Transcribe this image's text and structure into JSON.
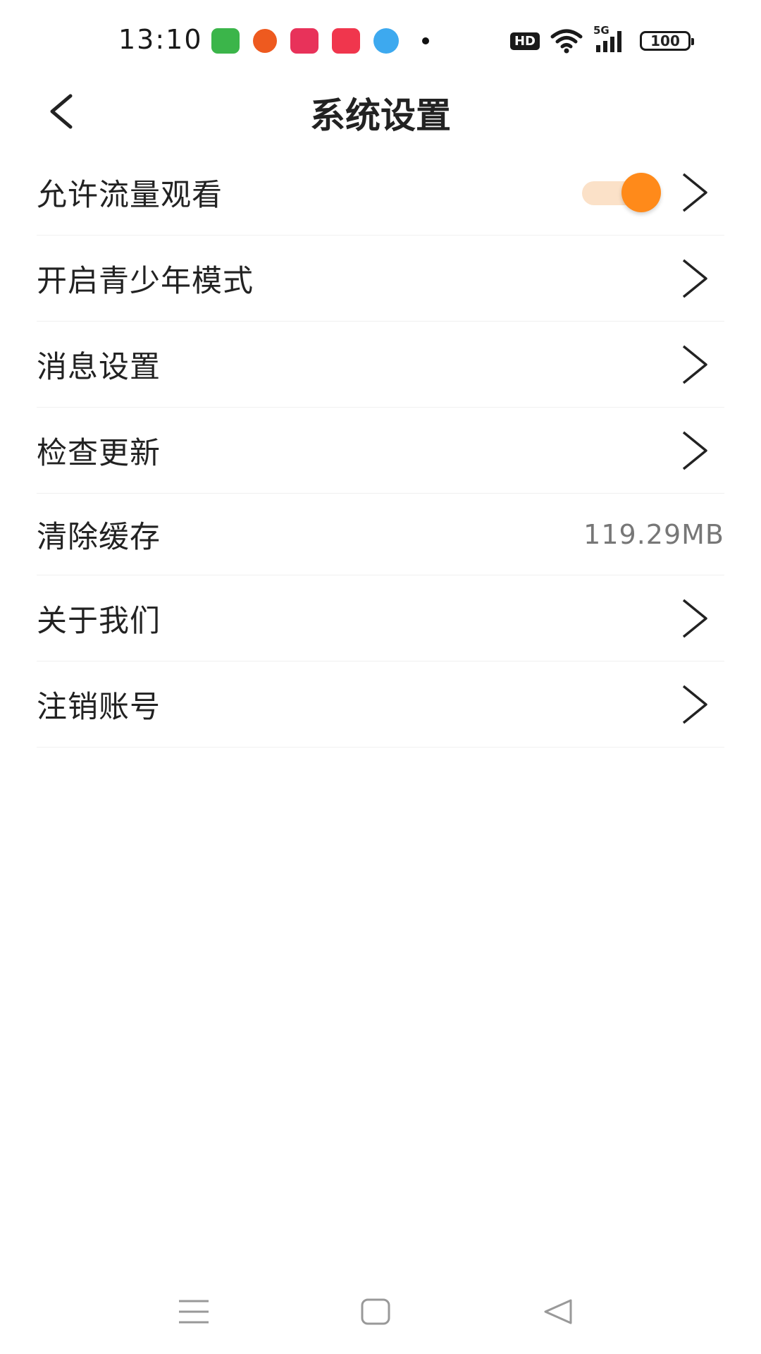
{
  "status_bar": {
    "time": "13:10",
    "hd_badge": "HD",
    "network": "5G",
    "battery": "100",
    "app_icons": [
      {
        "name": "green-app-icon",
        "color": "#3bb54a"
      },
      {
        "name": "orange-app-icon",
        "color": "#ee5a1f"
      },
      {
        "name": "video-app-icon",
        "color": "#e8325a"
      },
      {
        "name": "music-app-icon",
        "color": "#f0364d"
      },
      {
        "name": "cloud-app-icon",
        "color": "#3da9ef"
      }
    ]
  },
  "header": {
    "title": "系统设置",
    "back_icon": "chevron-left-icon"
  },
  "settings": {
    "items": [
      {
        "label": "允许流量观看",
        "type": "toggle",
        "checked": true,
        "accent": "#ff8a1a"
      },
      {
        "label": "开启青少年模式",
        "type": "link"
      },
      {
        "label": "消息设置",
        "type": "link"
      },
      {
        "label": "检查更新",
        "type": "link"
      },
      {
        "label": "清除缓存",
        "type": "value",
        "value": "119.29MB"
      },
      {
        "label": "关于我们",
        "type": "link"
      },
      {
        "label": "注销账号",
        "type": "link"
      }
    ]
  },
  "nav_bar": {
    "menu_icon": "menu-icon",
    "home_icon": "home-square-icon",
    "back_icon": "back-triangle-icon"
  }
}
